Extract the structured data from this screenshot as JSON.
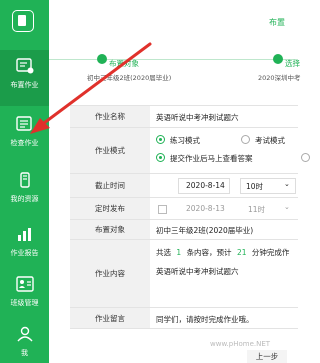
{
  "sidebar": {
    "items": [
      {
        "label": "布置作业",
        "icon": "assign-homework-icon"
      },
      {
        "label": "检查作业",
        "icon": "check-homework-icon"
      },
      {
        "label": "我的资源",
        "icon": "resources-icon"
      },
      {
        "label": "作业报告",
        "icon": "report-icon"
      },
      {
        "label": "班级管理",
        "icon": "class-management-icon"
      },
      {
        "label": "我",
        "icon": "profile-icon"
      }
    ]
  },
  "header": {
    "title": "布置"
  },
  "steps": {
    "step1": {
      "title": "布置对象",
      "sub": "初中三年级2班(2020届毕业)"
    },
    "step2": {
      "title": "选择",
      "sub": "2020深圳中考"
    }
  },
  "form": {
    "name_label": "作业名称",
    "name_value": "英语听说中考冲刺试题六",
    "mode_label": "作业模式",
    "mode_opt1": "练习模式",
    "mode_opt2": "考试模式",
    "mode_opt3": "提交作业后马上查看答案",
    "deadline_label": "截止时间",
    "deadline_date": "2020-8-14",
    "deadline_time": "10时",
    "schedule_label": "定时发布",
    "schedule_date": "2020-8-13",
    "schedule_time": "11时",
    "target_label": "布置对象",
    "target_value": "初中三年级2班(2020届毕业)",
    "content_label": "作业内容",
    "content_line1_a": "共选",
    "content_line1_count": "1",
    "content_line1_b": "条内容，预计",
    "content_line1_minutes": "21",
    "content_line1_c": "分钟完成作",
    "content_item": "英语听说中考冲刺试题六",
    "remark_label": "作业留言",
    "remark_value": "同学们，请按时完成作业哦。"
  },
  "buttons": {
    "prev": "上一步"
  },
  "watermark": "www.pHome.NET",
  "colors": {
    "accent": "#20b256",
    "arrow": "#e0312b"
  }
}
